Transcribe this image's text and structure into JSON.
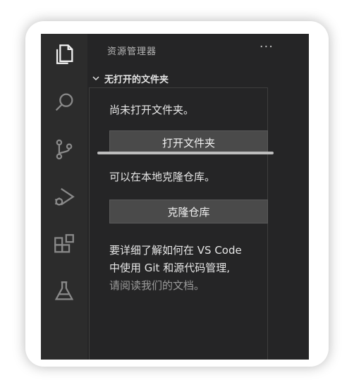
{
  "sidebar": {
    "title": "资源管理器",
    "more_label": "···",
    "section_title": "无打开的文件夹"
  },
  "activity_bar": {
    "items": [
      "files-icon",
      "search-icon",
      "source-control-icon",
      "run-debug-icon",
      "extensions-icon",
      "testing-icon"
    ]
  },
  "empty_view": {
    "no_folder_msg": "尚未打开文件夹。",
    "open_folder_button": "打开文件夹",
    "clone_msg": "可以在本地克隆仓库。",
    "clone_button": "克隆仓库",
    "help_line1": "要详细了解如何在 VS Code",
    "help_line2": "中使用 Git 和源代码管理,",
    "help_link": "请阅读我们的文档。"
  }
}
